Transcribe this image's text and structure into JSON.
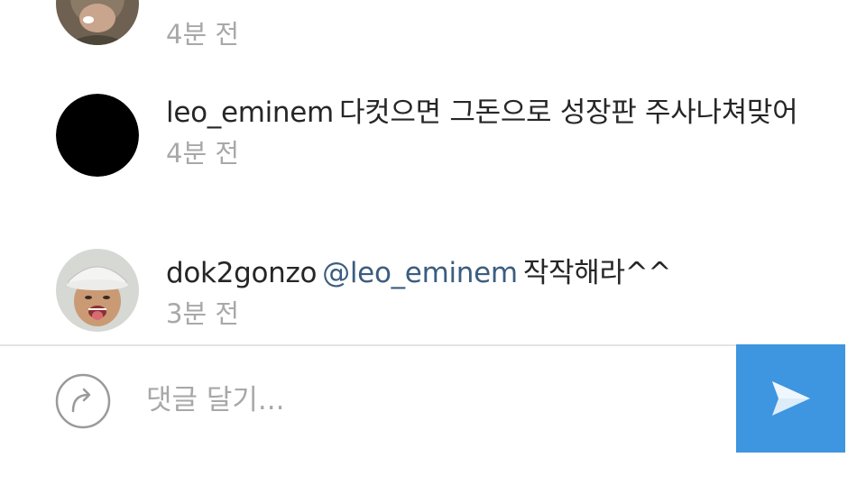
{
  "comments": [
    {
      "username": "",
      "text": "",
      "timestamp": "4분 전",
      "avatar_icon": "user-photo-avatar"
    },
    {
      "username": "leo_eminem",
      "text": "다컷으면 그돈으로 성장판 주사나쳐맞어",
      "timestamp": "4분 전",
      "avatar_icon": "black-circle-avatar"
    },
    {
      "username": "dok2gonzo",
      "mention": "@leo_eminem",
      "text": "작작해라^^",
      "timestamp": "3분 전",
      "avatar_icon": "user-photo-avatar"
    }
  ],
  "composer": {
    "placeholder": "댓글 달기...",
    "value": "",
    "reply_icon": "reply-arrow-icon",
    "send_icon": "send-arrow-icon"
  },
  "colors": {
    "text": "#262626",
    "timestamp": "#a8a8a8",
    "mention": "#3b5d80",
    "send_button": "#3e95e0",
    "divider": "#e4e4e4"
  }
}
